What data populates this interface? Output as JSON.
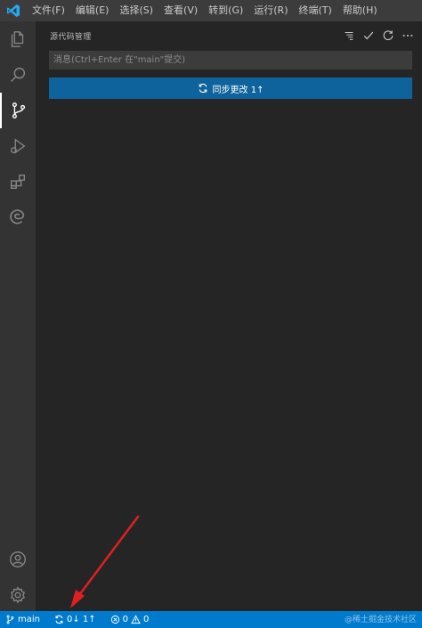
{
  "colors": {
    "titlebar": "#3c3c3c",
    "activitybar": "#333333",
    "sidebar": "#252526",
    "button": "#0e639c",
    "statusbar": "#007acc",
    "annotation_arrow": "#e02020"
  },
  "menu": {
    "items": [
      {
        "label": "文件(F)"
      },
      {
        "label": "编辑(E)"
      },
      {
        "label": "选择(S)"
      },
      {
        "label": "查看(V)"
      },
      {
        "label": "转到(G)"
      },
      {
        "label": "运行(R)"
      },
      {
        "label": "终端(T)"
      },
      {
        "label": "帮助(H)"
      }
    ]
  },
  "activitybar": {
    "icons": [
      "explorer-icon",
      "search-icon",
      "source-control-icon",
      "run-debug-icon",
      "extensions-icon",
      "edge-devtools-icon",
      "accounts-icon",
      "settings-gear-icon"
    ],
    "active": "source-control-icon"
  },
  "sidebar": {
    "title": "源代码管理",
    "actions": [
      "view-as-list-icon",
      "commit-check-icon",
      "refresh-icon",
      "more-actions-icon"
    ],
    "message_input": {
      "placeholder": "消息(Ctrl+Enter 在\"main\"提交)",
      "value": ""
    },
    "sync_button": {
      "label": "同步更改 1↑"
    }
  },
  "statusbar": {
    "branch": "main",
    "sync": "0↓ 1↑",
    "errors": "0",
    "warnings": "0"
  },
  "watermark": "@稀土掘金技术社区"
}
